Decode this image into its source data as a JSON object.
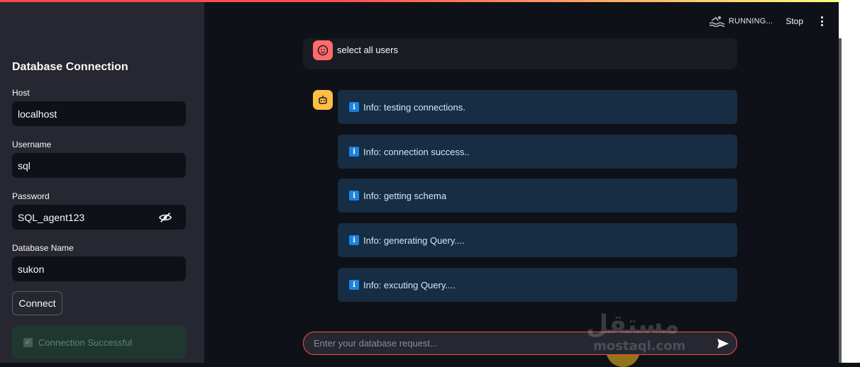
{
  "sidebar": {
    "title": "Database Connection",
    "host": {
      "label": "Host",
      "value": "localhost"
    },
    "username": {
      "label": "Username",
      "value": "sql"
    },
    "password": {
      "label": "Password",
      "value": "SQL_agent123"
    },
    "database": {
      "label": "Database Name",
      "value": "sukon"
    },
    "connect_label": "Connect",
    "success_text": "Connection Successful"
  },
  "header": {
    "status": "RUNNING...",
    "stop_label": "Stop"
  },
  "chat": {
    "user_message": "select all users",
    "info_messages": [
      "Info: testing connections.",
      "Info: connection success..",
      "Info: getting schema",
      "Info: generating Query....",
      "Info: excuting Query...."
    ],
    "input_placeholder": "Enter your database request..."
  },
  "watermark": {
    "arabic": "مستقل",
    "latin": "mostaql.com"
  },
  "colors": {
    "accent": "#ff4b4b",
    "info_bg": "#172d43",
    "user_avatar": "#ff6b6b",
    "bot_avatar": "#ffbd45"
  }
}
